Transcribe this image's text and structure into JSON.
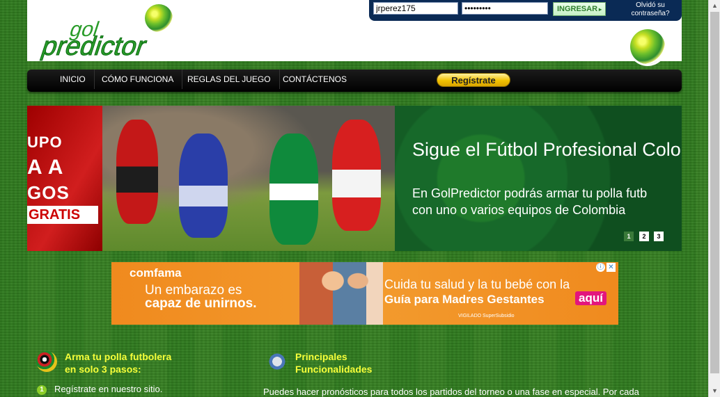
{
  "login": {
    "username_value": "jrperez175",
    "password_value": "•••••••••",
    "submit_label": "INGRESAR",
    "submit_arrow": "▸",
    "forgot_line1": "Olvidó su",
    "forgot_line2": "contraseña?"
  },
  "brand": {
    "logo_top": "gol",
    "logo_bottom": "predictor",
    "icon": "soccer-ball-icon",
    "colors": {
      "logo_green": "#2a9c2a",
      "nav_bg": "#000000",
      "title_yellow": "#f6ff3a",
      "register_gold": "#f2c200"
    }
  },
  "nav": {
    "items": [
      {
        "label": "INICIO"
      },
      {
        "label": "CÓMO FUNCIONA"
      },
      {
        "label": "REGLAS DEL JUEGO"
      },
      {
        "label": "CONTÁCTENOS"
      }
    ],
    "register_label": "Regístrate"
  },
  "banner": {
    "left_lines": [
      "UPO",
      "A  A",
      "GOS",
      "GRATIS"
    ],
    "title": "Sigue el Fútbol Profesional Colom",
    "subtitle_line1": "En GolPredictor podrás armar tu polla futb",
    "subtitle_line2": "con uno o varios equipos de Colombia",
    "pages": [
      "1",
      "2",
      "3"
    ],
    "active_page": "1"
  },
  "ad": {
    "brand": "comfama",
    "left_line1": "Un embarazo es",
    "left_line2": "capaz de unirnos.",
    "right_line1": "Cuida tu salud y la tu bebé con la",
    "right_line2": "Guía para Madres Gestantes",
    "cta": "aquí",
    "footer": "VIGILADO SuperSubsidio",
    "info_icon": "ⓘ",
    "close_icon": "✕"
  },
  "section1": {
    "title_line1": "Arma tu polla futbolera",
    "title_line2": "en solo 3 pasos:",
    "step1_number": "1",
    "step1_text": "Regístrate en nuestro sitio."
  },
  "section2": {
    "title_line1": "Principales",
    "title_line2": "Funcionalidades",
    "body": "Puedes hacer pronósticos para todos los partidos del torneo o una fase en especial. Por cada"
  },
  "scrollbar": {
    "up": "▲",
    "down": "▼"
  }
}
